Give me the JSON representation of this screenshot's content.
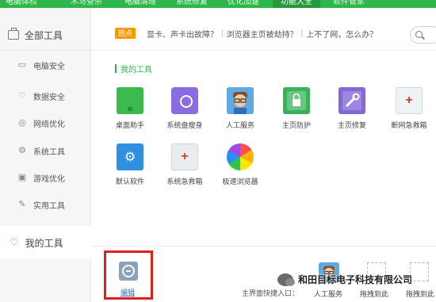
{
  "top_nav": {
    "tabs": [
      {
        "label": "电脑体检"
      },
      {
        "label": "木马查杀"
      },
      {
        "label": "电脑清理"
      },
      {
        "label": "系统修复"
      },
      {
        "label": "优化加速"
      },
      {
        "label": "功能大全"
      },
      {
        "label": "软件管家"
      }
    ],
    "active_index": 5
  },
  "sidebar": {
    "header": "全部工具",
    "items": [
      {
        "label": "电脑安全",
        "icon": "monitor-icon"
      },
      {
        "label": "数据安全",
        "icon": "pulse-icon"
      },
      {
        "label": "网络优化",
        "icon": "globe-icon"
      },
      {
        "label": "系统工具",
        "icon": "gear-icon"
      },
      {
        "label": "游戏优化",
        "icon": "gamepad-icon"
      },
      {
        "label": "实用工具",
        "icon": "wrench-icon"
      }
    ],
    "my_tools": "我的工具"
  },
  "hot": {
    "badge": "热点",
    "links": [
      "显卡、声卡出故障？",
      "浏览器主页被劫持？",
      "上不了网，怎么办？"
    ],
    "separator": "|"
  },
  "main": {
    "section_title": "我的工具",
    "tools": [
      {
        "label": "桌面助手",
        "icon": "desktop-assistant-icon"
      },
      {
        "label": "系统盘瘦身",
        "icon": "disk-slim-icon"
      },
      {
        "label": "人工服务",
        "icon": "human-service-icon"
      },
      {
        "label": "主页防护",
        "icon": "homepage-shield-icon"
      },
      {
        "label": "主页修复",
        "icon": "homepage-repair-icon"
      },
      {
        "label": "断网急救箱",
        "icon": "network-firstaid-icon"
      },
      {
        "label": "默认软件",
        "icon": "default-software-icon"
      },
      {
        "label": "系统急救箱",
        "icon": "system-firstaid-icon"
      },
      {
        "label": "极速浏览器",
        "icon": "browser-icon"
      }
    ]
  },
  "bottom": {
    "edit_label": "编辑",
    "quick_access_label": "主界面快捷入口：",
    "quick_tool_label": "人工服务",
    "drop_label": "拖拽到此",
    "watermark": "和田目标电子科技有限公司"
  },
  "colors": {
    "brand_green": "#2eb64a",
    "hot_orange": "#ff9900",
    "highlight_red": "#e01e1e",
    "link_blue": "#2a6fc9"
  }
}
